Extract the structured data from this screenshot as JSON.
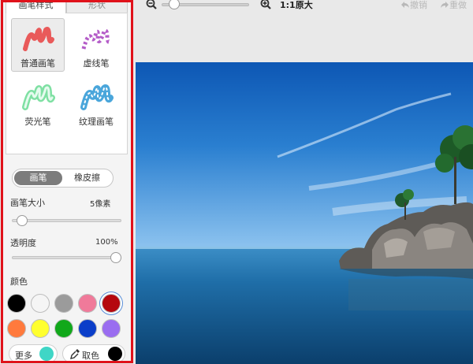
{
  "panel": {
    "tabs": [
      "画笔样式",
      "形状"
    ],
    "brushes": [
      {
        "label": "普通画笔",
        "icon": "plain-brush-icon",
        "color": "#e95a5a"
      },
      {
        "label": "虚线笔",
        "icon": "dashed-brush-icon",
        "color": "#b45cc8"
      },
      {
        "label": "荧光笔",
        "icon": "highlighter-brush-icon",
        "color": "#7fe0a3"
      },
      {
        "label": "纹理画笔",
        "icon": "texture-brush-icon",
        "color": "#4aa6db"
      }
    ],
    "mode": {
      "draw": "画笔",
      "eraser": "橡皮擦"
    },
    "size": {
      "label": "画笔大小",
      "value": "5像素",
      "level": 0.05
    },
    "opacity": {
      "label": "透明度",
      "value": "100%",
      "level": 1.0
    },
    "color_label": "颜色",
    "colors": [
      "#000000",
      "#f5f5f5",
      "#9b9b9b",
      "#f07a9a",
      "#b5080e",
      "#ff7a3d",
      "#ffff2e",
      "#11a81a",
      "#0b3ec9",
      "#9a6df0"
    ],
    "selected_color": "#b5080e",
    "more_label": "更多",
    "more_color": "#3fd6c6",
    "pick_label": "取色",
    "pick_color": "#000000"
  },
  "toolbar": {
    "zoom_label": "1:1原大",
    "undo_label": "撤销",
    "redo_label": "重做"
  }
}
